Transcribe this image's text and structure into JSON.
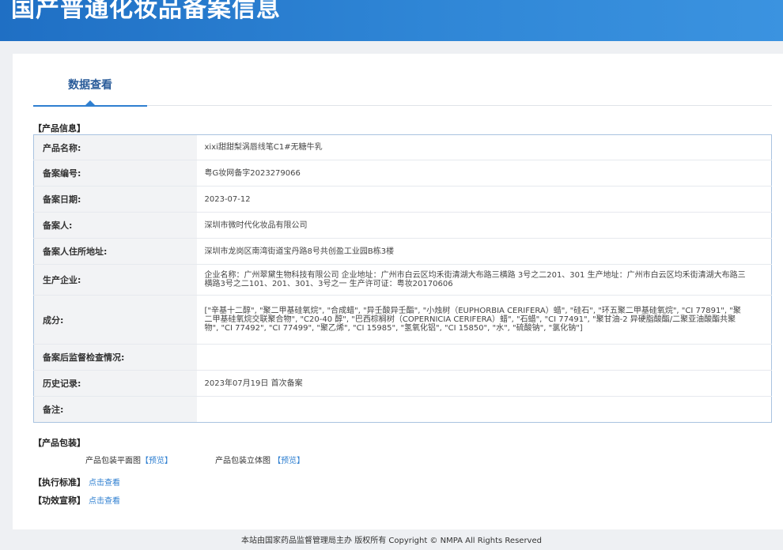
{
  "header": {
    "title": "国产普通化妆品备案信息"
  },
  "tabs": [
    {
      "label": "数据查看"
    }
  ],
  "product_info": {
    "section_label": "【产品信息】",
    "rows": [
      {
        "label": "产品名称:",
        "value": "xixi甜甜梨涡唇线笔C1#无糖牛乳"
      },
      {
        "label": "备案编号:",
        "value": "粤G妆网备字2023279066"
      },
      {
        "label": "备案日期:",
        "value": "2023-07-12"
      },
      {
        "label": "备案人:",
        "value": "深圳市微时代化妆品有限公司"
      },
      {
        "label": "备案人住所地址:",
        "value": "深圳市龙岗区南湾街道宝丹路8号共创盈工业园B栋3楼"
      },
      {
        "label": "生产企业:",
        "value": "企业名称：广州翠黛生物科技有限公司 企业地址：广州市白云区均禾街清湖大布路三横路 3号之二201、301 生产地址：广州市白云区均禾街清湖大布路三横路3号之二101、201、301、3号之一 生产许可证：粤妆20170606"
      },
      {
        "label": "成分:",
        "value": "[\"辛基十二醇\", \"聚二甲基硅氧烷\", \"合成蜡\", \"异壬酸异壬酯\", \"小烛树（EUPHORBIA CERIFERA）蜡\", \"硅石\", \"环五聚二甲基硅氧烷\", \"CI 77891\", \"聚二甲基硅氧烷交联聚合物\", \"C20-40 醇\", \"巴西棕榈树（COPERNICIA CERIFERA）蜡\", \"石蜡\", \"CI 77491\", \"聚甘油-2 异硬脂酸酯/二聚亚油酸酯共聚物\", \"CI 77492\", \"CI 77499\", \"聚乙烯\", \"CI 15985\", \"氢氧化铝\", \"CI 15850\", \"水\", \"硫酸钠\", \"氯化钠\"]"
      },
      {
        "label": "备案后监督检查情况:",
        "value": ""
      },
      {
        "label": "历史记录:",
        "value": "2023年07月19日 首次备案"
      },
      {
        "label": "备注:",
        "value": ""
      }
    ]
  },
  "packaging": {
    "section_label": "【产品包装】",
    "flat_label": "产品包装平面图",
    "flat_link": "【预览】",
    "solid_label": "产品包装立体图",
    "solid_link": "【预览】"
  },
  "standard": {
    "label": "【执行标准】",
    "link": "点击查看"
  },
  "efficacy": {
    "label": "【功效宣称】",
    "link": "点击查看"
  },
  "footer": {
    "text": "本站由国家药品监督管理局主办 版权所有 Copyright © NMPA All Rights Reserved"
  }
}
